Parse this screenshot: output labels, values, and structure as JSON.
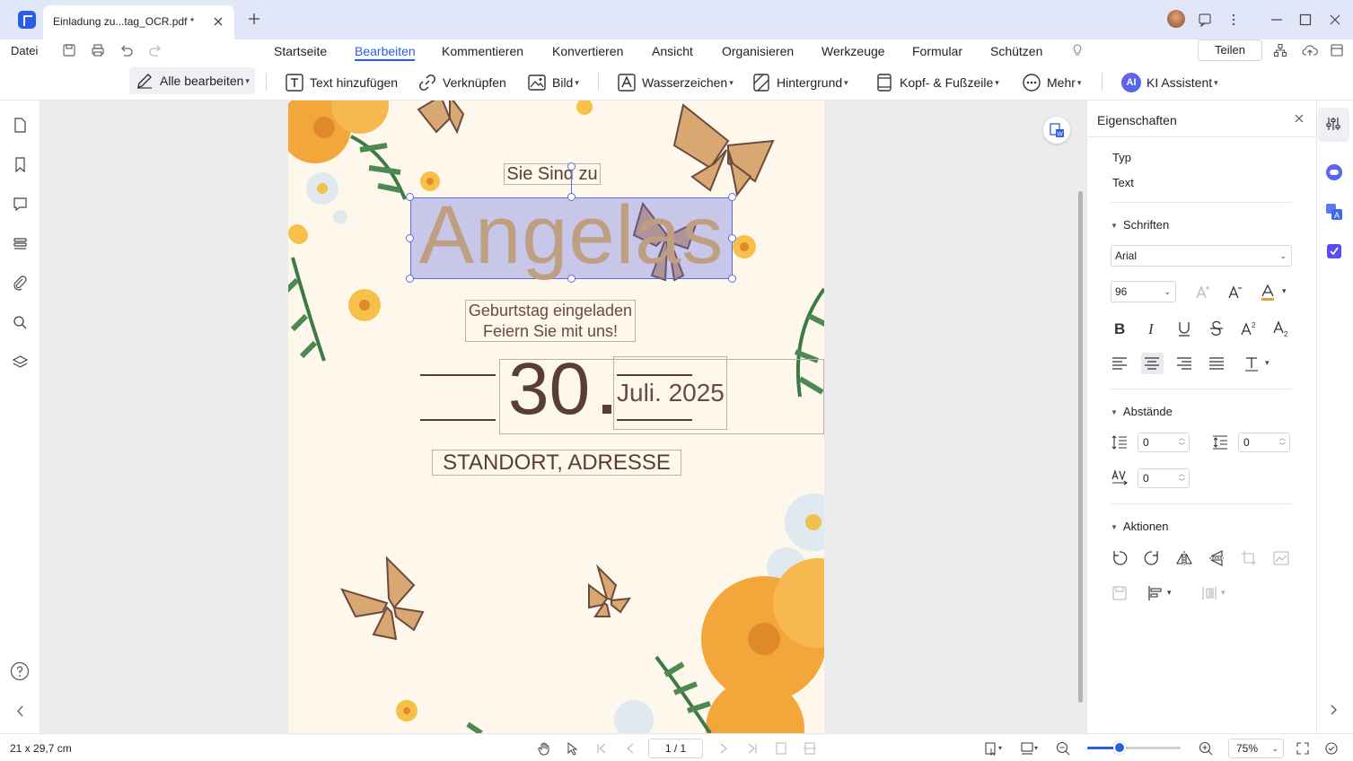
{
  "window": {
    "tab_title": "Einladung zu...tag_OCR.pdf *"
  },
  "menu": {
    "file": "Datei",
    "tabs": [
      "Startseite",
      "Bearbeiten",
      "Kommentieren",
      "Konvertieren",
      "Ansicht",
      "Organisieren",
      "Werkzeuge",
      "Formular",
      "Schützen"
    ],
    "active_tab": "Bearbeiten",
    "share": "Teilen"
  },
  "toolbar": {
    "edit_all": "Alle bearbeiten",
    "add_text": "Text hinzufügen",
    "link": "Verknüpfen",
    "image": "Bild",
    "watermark": "Wasserzeichen",
    "background": "Hintergrund",
    "header_footer": "Kopf- & Fußzeile",
    "more": "Mehr",
    "ai": "KI Assistent",
    "ai_badge": "AI"
  },
  "document": {
    "line1": "Sie Sind zu",
    "name": "Angelas",
    "line3a": "Geburtstag eingeladen",
    "line3b": "Feiern Sie mit uns!",
    "day": "30",
    "month_year": "Juli. 2025",
    "location": "STANDORT, ADRESSE"
  },
  "panel": {
    "title": "Eigenschaften",
    "type_label": "Typ",
    "type_value": "Text",
    "fonts_section": "Schriften",
    "font_family": "Arial",
    "font_size": "96",
    "spacing_section": "Abstände",
    "line_spacing": "0",
    "paragraph_spacing": "0",
    "char_spacing": "0",
    "actions_section": "Aktionen"
  },
  "status": {
    "page_size": "21 x 29,7 cm",
    "page_indicator": "1 / 1",
    "zoom": "75%",
    "zoom_level_fraction": 0.35
  },
  "colors": {
    "accent": "#2b5ce6",
    "selection": "#5b6be0",
    "page_bg": "#fdf7ec",
    "text_brown": "#5a3e33",
    "name_color": "#bf9f82"
  }
}
